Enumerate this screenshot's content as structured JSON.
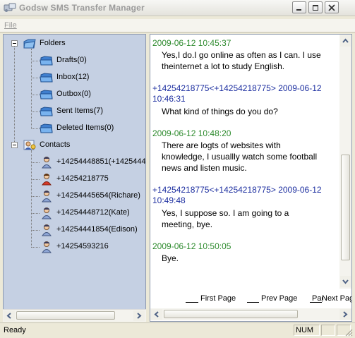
{
  "window": {
    "title": "Godsw SMS Transfer Manager"
  },
  "menu": {
    "items": [
      {
        "label": "File"
      }
    ]
  },
  "tree": {
    "folders": {
      "label": "Folders",
      "items": [
        {
          "label": "Drafts(0)"
        },
        {
          "label": "Inbox(12)"
        },
        {
          "label": "Outbox(0)"
        },
        {
          "label": "Sent Items(7)"
        },
        {
          "label": "Deleted Items(0)"
        }
      ]
    },
    "contacts": {
      "label": "Contacts",
      "items": [
        {
          "label": "+14254448851(+1425444"
        },
        {
          "label": "+14254218775"
        },
        {
          "label": "+14254445654(Richare)"
        },
        {
          "label": "+14254448712(Kate)"
        },
        {
          "label": "+14254441854(Edison)"
        },
        {
          "label": "+14254593216"
        }
      ]
    }
  },
  "messages": [
    {
      "header": "2009-06-12 10:45:37",
      "header_lines": [
        "2009-06-12 10:45:37"
      ],
      "color": "#2e8b2e",
      "body_lines": [
        "Yes,I do.I go online as often as I can. I use",
        "theinternet a lot to study English."
      ]
    },
    {
      "header": "+14254218775<+14254218775> 2009-06-12 10:46:31",
      "header_lines": [
        "+14254218775<+14254218775> 2009-06-12",
        "10:46:31"
      ],
      "color": "#1d2fa0",
      "body_lines": [
        "What kind of things do you do?"
      ]
    },
    {
      "header": "2009-06-12 10:48:20",
      "header_lines": [
        "2009-06-12 10:48:20"
      ],
      "color": "#2e8b2e",
      "body_lines": [
        "There are logts of websites with",
        "knowledge, I usuallly watch some football",
        "news and listen music."
      ]
    },
    {
      "header": "+14254218775<+14254218775> 2009-06-12 10:49:48",
      "header_lines": [
        "+14254218775<+14254218775> 2009-06-12",
        "10:49:48"
      ],
      "color": "#1d2fa0",
      "body_lines": [
        "Yes, I suppose so. I am going to a",
        "meeting, bye."
      ]
    },
    {
      "header": "2009-06-12 10:50:05",
      "header_lines": [
        "2009-06-12 10:50:05"
      ],
      "color": "#2e8b2e",
      "body_lines": [
        "Bye."
      ]
    }
  ],
  "pager": {
    "first": "First Page",
    "prev": "Prev Page",
    "page": "Page",
    "next": "Next Page"
  },
  "status": {
    "ready": "Ready",
    "num": "NUM"
  },
  "icons": {
    "app": "sms-transfer-icon",
    "folder": "folder-icon",
    "contacts": "contacts-icon",
    "contact": "person-icon",
    "minimize": "minimize-icon",
    "maximize": "maximize-icon",
    "close": "close-icon"
  }
}
